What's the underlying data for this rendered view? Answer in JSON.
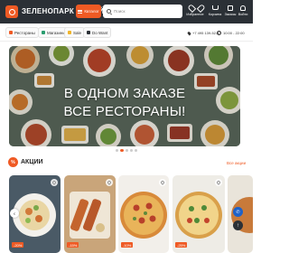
{
  "header": {
    "brand": "ЗЕЛЕНОПАРК ОНЛАЙН",
    "catalog_label": "Каталог",
    "search_placeholder": "Поиск",
    "favorites_label": "Избранное",
    "cart_label": "Корзина",
    "orders_label": "Заказы",
    "login_label": "Войти"
  },
  "categories": [
    {
      "label": "Рестораны",
      "color": "#ef5a24"
    },
    {
      "label": "Магазины",
      "color": "#2a9d6f"
    },
    {
      "label": "Sale",
      "color": "#f0b429"
    },
    {
      "label": "Do Want",
      "color": "#2b3036"
    }
  ],
  "contacts": {
    "phone": "+7 495 139-52-40",
    "hours": "10:00 - 22:00"
  },
  "banner": {
    "line1": "В ОДНОМ ЗАКАЗЕ",
    "line2": "ВСЕ РЕСТОРАНЫ!",
    "current_slide": 2,
    "total_slides": 5
  },
  "promo": {
    "badge": "%",
    "title": "АКЦИИ",
    "show_all": "Все акции",
    "cards": [
      {
        "discount": "-20%"
      },
      {
        "discount": "-15%"
      },
      {
        "discount": "-10%"
      },
      {
        "discount": "-25%"
      }
    ]
  },
  "colors": {
    "accent": "#ef5a24",
    "header_bg": "#2b3036",
    "call_button": "#1e62c8"
  },
  "icons": [
    "logo-icon",
    "burger-icon",
    "search-icon",
    "heart-icon",
    "cart-icon",
    "bag-icon",
    "user-icon",
    "location-icon",
    "clock-icon",
    "chevron-left-icon",
    "phone-icon",
    "arrow-up-icon"
  ]
}
